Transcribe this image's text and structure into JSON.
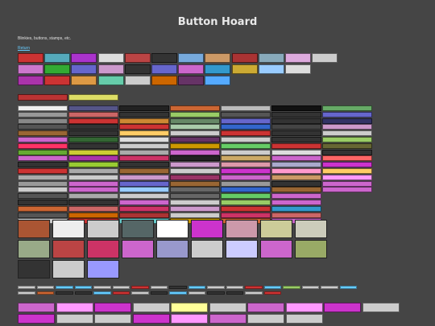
{
  "page": {
    "title": "Button Hoard",
    "subtitle": "Blinkies, buttons, stamps, etc.",
    "return_link": "Return"
  },
  "sections": {
    "buttons_88x31": {
      "rows": [
        [
          "#c33",
          "#5ab",
          "#a3c",
          "#ddd",
          "#b44",
          "#333",
          "#7ad",
          "#c96",
          "#a33",
          "#8ab",
          "#dad",
          "#ccc"
        ],
        [
          "#c7c",
          "#3a3",
          "#66c",
          "#c9c",
          "#333",
          "#66c",
          "#c6c",
          "#39c",
          "#ca3",
          "#9cf",
          "#ddd"
        ],
        [
          "#a3a",
          "#c33",
          "#d94",
          "#6ca",
          "#ccc",
          "#c60",
          "#636",
          "#5af"
        ]
      ]
    },
    "blinkies": {
      "header_labels": [
        "#b33",
        "#dd6"
      ],
      "rows": [
        [
          "#eee",
          "#558",
          "#222",
          "#c63",
          "#bbb",
          "#111",
          "#6a6"
        ],
        [
          "#999",
          "#c66",
          "#333",
          "#9c6",
          "#555",
          "#333",
          "#66c"
        ],
        [
          "#888",
          "#c33",
          "#c83",
          "#686",
          "#66c",
          "#333",
          "#336"
        ],
        [
          "#555",
          "#333",
          "#c33",
          "#aca",
          "#36c",
          "#444",
          "#c9c"
        ],
        [
          "#963",
          "#333",
          "#fc6",
          "#ccc",
          "#c33",
          "#333",
          "#ccc"
        ],
        [
          "#c6c",
          "#363",
          "#ddd",
          "#636",
          "#ccc",
          "#333",
          "#9c6"
        ],
        [
          "#f36",
          "#333",
          "#ccc",
          "#c90",
          "#6c6",
          "#c33",
          "#663"
        ],
        [
          "#6a3",
          "#cc3",
          "#aaa",
          "#c6c",
          "#ccc",
          "#ddd",
          "#333"
        ],
        [
          "#c6c",
          "#a3a",
          "#c36",
          "#222",
          "#ca6",
          "#c6c",
          "#f66"
        ],
        [
          "#333",
          "#9c3",
          "#333",
          "#c9c",
          "#d9a",
          "#aac",
          "#c3c"
        ],
        [
          "#c33",
          "#aaa",
          "#963",
          "#ccc",
          "#c3c",
          "#f9c",
          "#fc6"
        ],
        [
          "#aaa",
          "#ccc",
          "#c9c",
          "#936",
          "#c6c",
          "#c96",
          "#f9f"
        ],
        [
          "#999",
          "#c6c",
          "#66c",
          "#963",
          "#999",
          "#333",
          "#c6c"
        ],
        [
          "#ccc",
          "#c6c",
          "#9cf",
          "#666",
          "#36c",
          "#963",
          "#c6c"
        ],
        [
          "#555",
          "#aaa",
          "#ccc",
          "#666",
          "#6c6",
          "#c6c",
          ""
        ],
        [
          "#333",
          "#333",
          "#c6c",
          "#ccc",
          "#9c6",
          "#c6c",
          ""
        ],
        [
          "#c63",
          "#c66",
          "#c36",
          "#c9c",
          "#c33",
          "#39c",
          ""
        ],
        [
          "#555",
          "#c60",
          "#a33",
          "#ccc",
          "#c36",
          "#c66",
          ""
        ],
        [
          "#ccc",
          "#c33",
          "#6cc",
          "#c90",
          "#c63",
          "#c6c",
          ""
        ]
      ]
    },
    "stamps": {
      "rows": [
        [
          "#a53",
          "#eee",
          "#ccc",
          "#566",
          "#fff",
          "#c3c",
          "#c9a",
          "#cc9",
          "#ccb"
        ],
        [
          "#9a8",
          "#b44",
          "#c36",
          "#c6c",
          "#99c",
          "#ccc",
          "#ccf",
          "#c6c",
          "#9a6"
        ],
        [
          "#333",
          "#ccc",
          "#99f"
        ]
      ]
    },
    "tiny_buttons": {
      "rows": [
        [
          "#ccc",
          "#ccc",
          "#6cf",
          "#6cf",
          "#ccc",
          "#ccc",
          "#c33",
          "#ccc",
          "#333",
          "#6cf",
          "#ccc",
          "#ccc",
          "#c33",
          "#6cf",
          "#9c6",
          "#ccc",
          "#ccc",
          "#6cf"
        ],
        [
          "#ccc",
          "#c63",
          "#333",
          "#333",
          "#6cf",
          "#c33",
          "#ccc",
          "#333",
          "#6cf",
          "#ccc",
          "#333",
          "#333",
          "#ccc",
          "#c33"
        ]
      ]
    },
    "user_buttons": {
      "rows": [
        [
          "#c6c",
          "#f9f",
          "#c3c",
          "#ccc",
          "#ff9",
          "#ccc",
          "#c6c",
          "#f9f",
          "#c3c",
          "#ccc"
        ],
        [
          "#c3c",
          "#ccc",
          "#ccc",
          "#c3c",
          "#f9f",
          "#c6c",
          "#ccc",
          "#ccc"
        ]
      ]
    }
  }
}
